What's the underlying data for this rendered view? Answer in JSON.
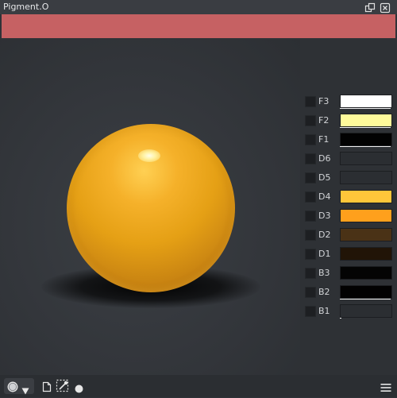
{
  "window": {
    "title": "Pigment.O"
  },
  "icons": {
    "float": "float-window-icon",
    "close": "close-icon",
    "mode": "circle-mode-icon",
    "dropdown": "dropdown-arrow-icon",
    "document": "document-icon",
    "picker": "color-picker-icon",
    "dot": "dot-icon",
    "menu": "hamburger-menu-icon"
  },
  "current_color": "#c66163",
  "sphere_color": "#e5a015",
  "swatches": [
    {
      "label": "F3",
      "color": "#ffffff"
    },
    {
      "label": "F2",
      "color": "#fffb9b"
    },
    {
      "label": "F1",
      "color": "#020202"
    },
    {
      "label": "D6",
      "color": "#2b2e32"
    },
    {
      "label": "D5",
      "color": "#2b2e32"
    },
    {
      "label": "D4",
      "color": "#ffc63a"
    },
    {
      "label": "D3",
      "color": "#ffa01c"
    },
    {
      "label": "D2",
      "color": "#4a3216"
    },
    {
      "label": "D1",
      "color": "#211407"
    },
    {
      "label": "B3",
      "color": "#040404"
    },
    {
      "label": "B2",
      "color": "#020202"
    },
    {
      "label": "B1",
      "color": "#2b2e32"
    }
  ]
}
